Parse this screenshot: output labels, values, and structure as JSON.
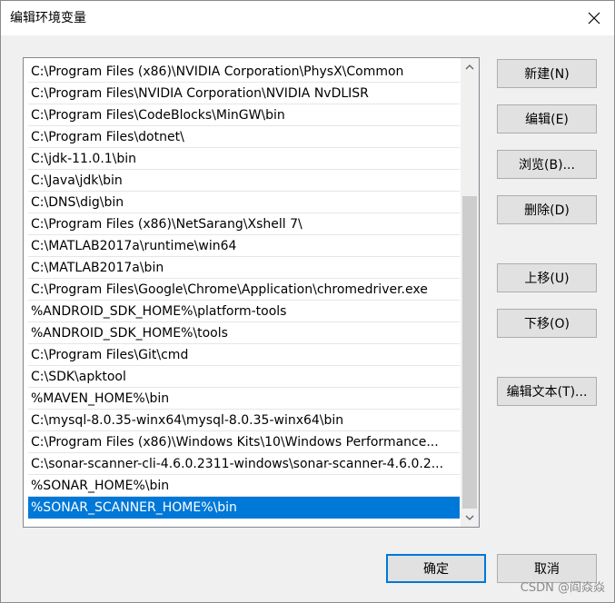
{
  "window": {
    "title": "编辑环境变量"
  },
  "list": {
    "items": [
      "C:\\Program Files (x86)\\NVIDIA Corporation\\PhysX\\Common",
      "C:\\Program Files\\NVIDIA Corporation\\NVIDIA NvDLISR",
      "C:\\Program Files\\CodeBlocks\\MinGW\\bin",
      "C:\\Program Files\\dotnet\\",
      "C:\\jdk-11.0.1\\bin",
      "C:\\Java\\jdk\\bin",
      "C:\\DNS\\dig\\bin",
      "C:\\Program Files (x86)\\NetSarang\\Xshell 7\\",
      "C:\\MATLAB2017a\\runtime\\win64",
      "C:\\MATLAB2017a\\bin",
      "C:\\Program Files\\Google\\Chrome\\Application\\chromedriver.exe",
      "%ANDROID_SDK_HOME%\\platform-tools",
      "%ANDROID_SDK_HOME%\\tools",
      "C:\\Program Files\\Git\\cmd",
      "C:\\SDK\\apktool",
      "%MAVEN_HOME%\\bin",
      "C:\\mysql-8.0.35-winx64\\mysql-8.0.35-winx64\\bin",
      "C:\\Program Files (x86)\\Windows Kits\\10\\Windows Performance...",
      "C:\\sonar-scanner-cli-4.6.0.2311-windows\\sonar-scanner-4.6.0.2...",
      "%SONAR_HOME%\\bin",
      "%SONAR_SCANNER_HOME%\\bin"
    ],
    "selected_index": 20
  },
  "buttons": {
    "new": "新建(N)",
    "edit": "编辑(E)",
    "browse": "浏览(B)...",
    "delete": "删除(D)",
    "move_up": "上移(U)",
    "move_down": "下移(O)",
    "edit_text": "编辑文本(T)...",
    "ok": "确定",
    "cancel": "取消"
  },
  "watermark": "CSDN @阎焱焱",
  "colors": {
    "selection": "#0078d7",
    "default_button_border": "#0078d7"
  },
  "icons": {
    "close": "close-icon",
    "scroll_up": "chevron-up-icon",
    "scroll_down": "chevron-down-icon"
  }
}
